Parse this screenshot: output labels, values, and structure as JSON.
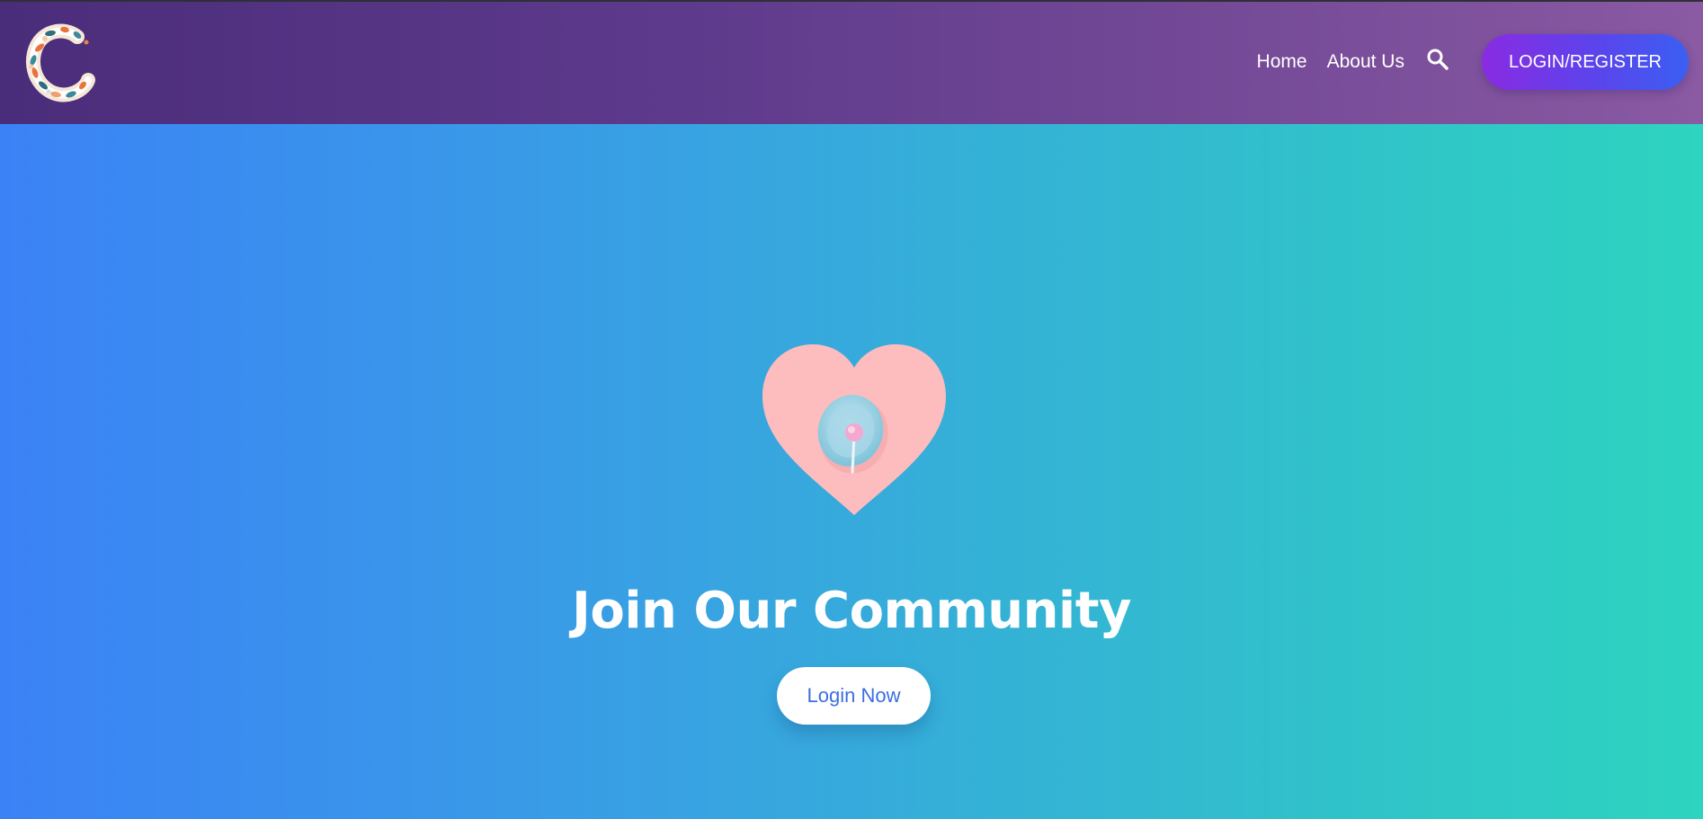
{
  "nav": {
    "logo_icon": "floral-letter-c-logo",
    "links": [
      {
        "label": "Home"
      },
      {
        "label": "About Us"
      }
    ],
    "search_icon": "search-icon",
    "login_register_label": "LOGIN/REGISTER"
  },
  "hero": {
    "image_icon": "pink-heart-with-lollipop-image",
    "title": "Join Our Community",
    "cta_label": "Login Now"
  },
  "colors": {
    "navbar_start": "#4a2d7a",
    "navbar_end": "#8a5aa3",
    "hero_start": "#3b82f6",
    "hero_end": "#2dd4bf",
    "button_gradient_start": "#8a2be2",
    "button_gradient_end": "#3b5ff2",
    "cta_text": "#3b6fe0"
  }
}
